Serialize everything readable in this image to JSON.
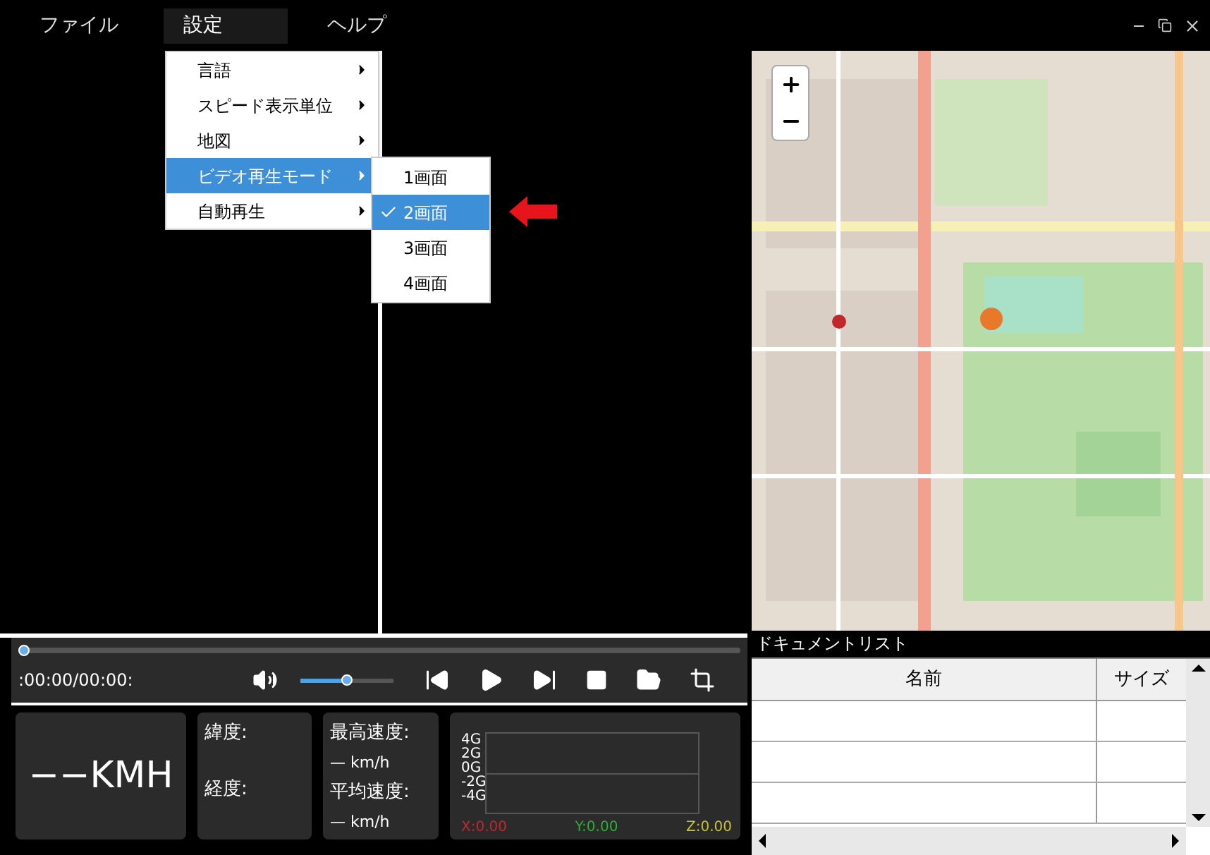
{
  "menu_bar": [
    {
      "label": "ファイル",
      "selected": false
    },
    {
      "label": "設定",
      "selected": true
    },
    {
      "label": "ヘルプ",
      "selected": false
    }
  ],
  "settings_menu": [
    {
      "label": "言語",
      "selected": false
    },
    {
      "label": "スピード表示単位",
      "selected": false
    },
    {
      "label": "地図",
      "selected": false
    },
    {
      "label": "ビデオ再生モード",
      "selected": true
    },
    {
      "label": "自動再生",
      "selected": false
    }
  ],
  "playback_mode_menu": [
    {
      "label": "1画面",
      "checked": false,
      "selected": false
    },
    {
      "label": "2画面",
      "checked": true,
      "selected": true
    },
    {
      "label": "3画面",
      "checked": false,
      "selected": false
    },
    {
      "label": "4画面",
      "checked": false,
      "selected": false
    }
  ],
  "player": {
    "time": ":00:00/00:00:",
    "progress": {
      "level": 0
    },
    "volume": {
      "level": 0.5
    }
  },
  "speed_panel": {
    "value": "−−KMH"
  },
  "position_panel": {
    "latitude_label": "緯度:",
    "longitude_label": "経度:"
  },
  "speed_stats": {
    "max_label": "最高速度:",
    "max_value": "— km/h",
    "avg_label": "平均速度:",
    "avg_value": "— km/h"
  },
  "g_sensor": {
    "scale": [
      "4G",
      "2G",
      "0G",
      "-2G",
      "-4G"
    ],
    "readings": [
      {
        "text": "X:0.00",
        "color": "#c0282d"
      },
      {
        "text": "Y:0.00",
        "color": "#2fae3a"
      },
      {
        "text": "Z:0.00",
        "color": "#c8c03a"
      }
    ]
  },
  "document_list": {
    "title": "ドキュメントリスト",
    "columns": [
      "名前",
      "サイズ"
    ]
  }
}
